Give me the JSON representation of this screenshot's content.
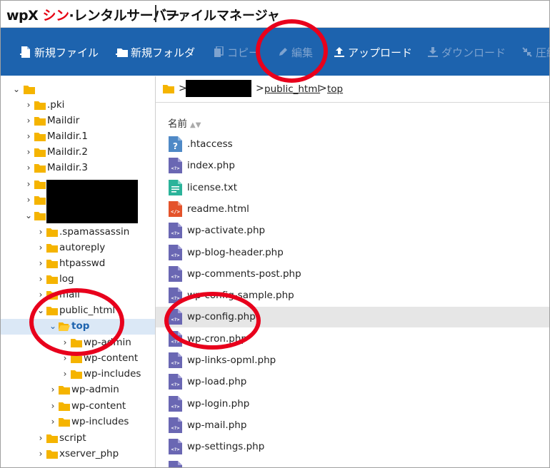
{
  "header": {
    "logo_wp": "wpX",
    "logo_sin": "シン",
    "logo_rest": "·レンタルサーバー",
    "title": "ファイルマネージャ"
  },
  "toolbar": {
    "new_file": "新規ファイル",
    "new_folder": "新規フォルダ",
    "copy": "コピー",
    "edit": "編集",
    "upload": "アップロード",
    "download": "ダウンロード",
    "compress": "圧縮"
  },
  "tree": {
    "items": [
      {
        "label": ""
      },
      {
        "label": ".pki"
      },
      {
        "label": "Maildir"
      },
      {
        "label": "Maildir.1"
      },
      {
        "label": "Maildir.2"
      },
      {
        "label": "Maildir.3"
      },
      {
        "label": ""
      },
      {
        "label": ""
      },
      {
        "label": ""
      },
      {
        "label": ".spamassassin"
      },
      {
        "label": "autoreply"
      },
      {
        "label": "htpasswd"
      },
      {
        "label": "log"
      },
      {
        "label": "mail"
      },
      {
        "label": "public_html"
      },
      {
        "label": "top"
      },
      {
        "label": "wp-admin"
      },
      {
        "label": "wp-content"
      },
      {
        "label": "wp-includes"
      },
      {
        "label": "wp-admin"
      },
      {
        "label": "wp-content"
      },
      {
        "label": "wp-includes"
      },
      {
        "label": "script"
      },
      {
        "label": "xserver_php"
      }
    ]
  },
  "breadcrumb": {
    "sep": ">",
    "public_html": "public_html",
    "top": "top"
  },
  "filelist": {
    "header_name": "名前",
    "sort_icon": "sort-icon",
    "files": [
      {
        "name": ".htaccess",
        "icon": "unknown-file-icon"
      },
      {
        "name": "index.php",
        "icon": "php-file-icon"
      },
      {
        "name": "license.txt",
        "icon": "text-file-icon"
      },
      {
        "name": "readme.html",
        "icon": "html-file-icon"
      },
      {
        "name": "wp-activate.php",
        "icon": "php-file-icon"
      },
      {
        "name": "wp-blog-header.php",
        "icon": "php-file-icon"
      },
      {
        "name": "wp-comments-post.php",
        "icon": "php-file-icon"
      },
      {
        "name": "wp-config-sample.php",
        "icon": "php-file-icon"
      },
      {
        "name": "wp-config.php",
        "icon": "php-file-icon"
      },
      {
        "name": "wp-cron.php",
        "icon": "php-file-icon"
      },
      {
        "name": "wp-links-opml.php",
        "icon": "php-file-icon"
      },
      {
        "name": "wp-load.php",
        "icon": "php-file-icon"
      },
      {
        "name": "wp-login.php",
        "icon": "php-file-icon"
      },
      {
        "name": "wp-mail.php",
        "icon": "php-file-icon"
      },
      {
        "name": "wp-settings.php",
        "icon": "php-file-icon"
      }
    ]
  },
  "colors": {
    "toolbar": "#1d63ae",
    "annotation": "#e8001c",
    "selected_row": "#dbe8f6",
    "highlight_row": "#e6e6e6",
    "folder": "#f5b400"
  }
}
